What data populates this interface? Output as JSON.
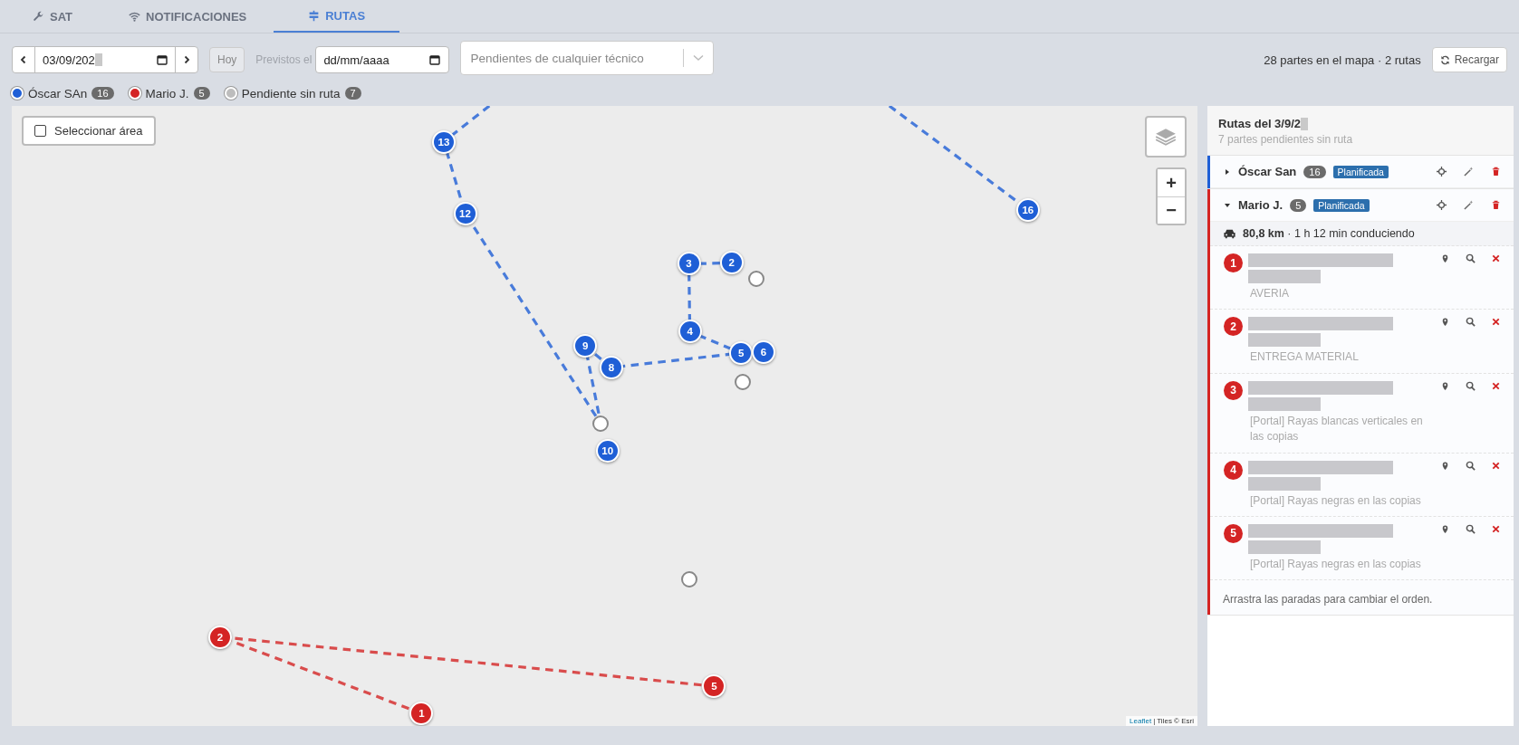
{
  "tabs": [
    {
      "label": "SAT",
      "selected": false
    },
    {
      "label": "NOTIFICACIONES",
      "selected": false
    },
    {
      "label": "RUTAS",
      "selected": true
    }
  ],
  "toolbar": {
    "date_value": "03/09/202",
    "today_button": "Hoy",
    "planned_label": "Previstos el",
    "planned_placeholder": "dd/mm/aaaa",
    "technician_placeholder": "Pendientes de cualquier técnico",
    "summary": "28 partes en el mapa · 2 rutas",
    "reload_button": "Recargar"
  },
  "legend": [
    {
      "name": "Óscar SAn",
      "count": "16",
      "color": "#1f5fd6"
    },
    {
      "name": "Mario J.",
      "count": "5",
      "color": "#d42424"
    },
    {
      "name": "Pendiente sin ruta",
      "count": "7",
      "color": "#bdbdbd"
    }
  ],
  "map": {
    "select_area": "Seleccionar área",
    "select_checked": false,
    "zoom_in": "+",
    "zoom_out": "−",
    "attribution_link": "Leaflet",
    "attribution": "| Tiles © Esri",
    "markers": [
      {
        "kind": "route",
        "label": "13",
        "color": "#1f5fd6"
      },
      {
        "kind": "route",
        "label": "12",
        "color": "#1f5fd6"
      },
      {
        "kind": "route",
        "label": "3",
        "color": "#1f5fd6"
      },
      {
        "kind": "route",
        "label": "2",
        "color": "#1f5fd6"
      },
      {
        "kind": "route",
        "label": "4",
        "color": "#1f5fd6"
      },
      {
        "kind": "route",
        "label": "5",
        "color": "#1f5fd6"
      },
      {
        "kind": "route",
        "label": "6",
        "color": "#1f5fd6"
      },
      {
        "kind": "route",
        "label": "9",
        "color": "#1f5fd6"
      },
      {
        "kind": "route",
        "label": "8",
        "color": "#1f5fd6"
      },
      {
        "kind": "route",
        "label": "10",
        "color": "#1f5fd6"
      },
      {
        "kind": "route",
        "label": "16",
        "color": "#1f5fd6"
      },
      {
        "kind": "pending"
      },
      {
        "kind": "pending"
      },
      {
        "kind": "pending"
      },
      {
        "kind": "pending"
      },
      {
        "kind": "route",
        "label": "2",
        "color": "#d42424"
      },
      {
        "kind": "route",
        "label": "1",
        "color": "#d42424"
      },
      {
        "kind": "route",
        "label": "5",
        "color": "#d42424"
      }
    ]
  },
  "panel": {
    "title": "Rutas del 3/9/2",
    "subtitle": "7 partes pendientes sin ruta",
    "routes": [
      {
        "name": "Óscar San",
        "count": "16",
        "status": "Planificada",
        "color": "#1f5fd6",
        "expanded": false
      },
      {
        "name": "Mario J.",
        "count": "5",
        "status": "Planificada",
        "color": "#d42424",
        "expanded": true,
        "distance": "80,8 km",
        "duration": "· 1 h 12 min conduciendo",
        "stops": [
          {
            "number": "1",
            "description": "AVERIA"
          },
          {
            "number": "2",
            "description": "ENTREGA MATERIAL"
          },
          {
            "number": "3",
            "description": "[Portal] Rayas blancas verticales en las copias"
          },
          {
            "number": "4",
            "description": "[Portal] Rayas negras en las copias"
          },
          {
            "number": "5",
            "description": "[Portal] Rayas negras en las copias"
          }
        ]
      }
    ],
    "hint": "Arrastra las paradas para cambiar el orden."
  }
}
